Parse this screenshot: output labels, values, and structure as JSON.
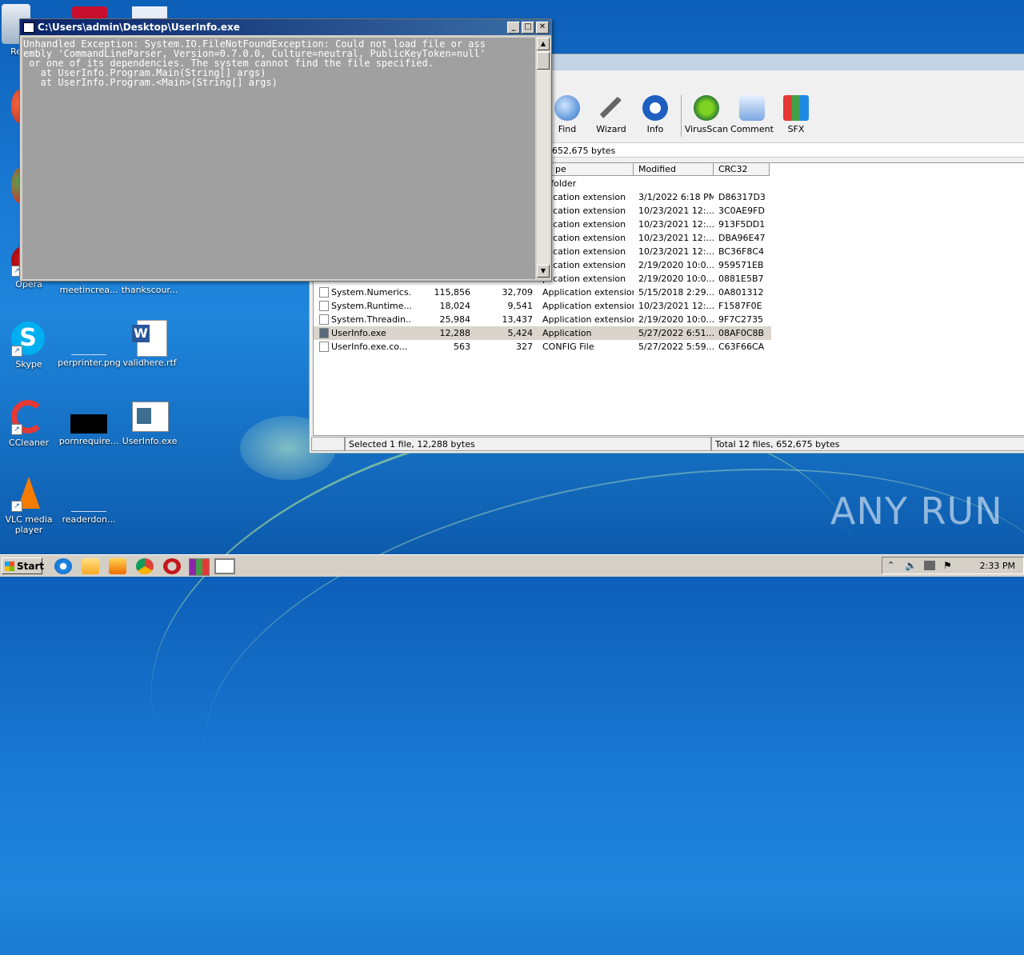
{
  "console": {
    "title": "C:\\Users\\admin\\Desktop\\UserInfo.exe",
    "lines": [
      "Unhandled Exception: System.IO.FileNotFoundException: Could not load file or ass",
      "embly 'CommandLineParser, Version=0.7.0.0, Culture=neutral, PublicKeyToken=null'",
      " or one of its dependencies. The system cannot find the file specified.",
      "   at UserInfo.Program.Main(String[] args)",
      "   at UserInfo.Program.<Main>(String[] args)"
    ],
    "btn_min": "_",
    "btn_max": "□",
    "btn_close": "✕"
  },
  "winrar": {
    "toolbar": [
      "Find",
      "Wizard",
      "Info",
      "VirusScan",
      "Comment",
      "SFX"
    ],
    "address": "652,675 bytes",
    "columns": [
      "pe",
      "Modified",
      "CRC32"
    ],
    "rows": [
      {
        "name": "",
        "size": "",
        "packed": "",
        "type": "e folder",
        "modified": "",
        "crc": ""
      },
      {
        "name": "",
        "size": "",
        "packed": "",
        "type": "plication extension",
        "modified": "3/1/2022 6:18 PM",
        "crc": "D86317D3"
      },
      {
        "name": "",
        "size": "",
        "packed": "",
        "type": "plication extension",
        "modified": "10/23/2021 12:...",
        "crc": "3C0AE9FD"
      },
      {
        "name": "",
        "size": "",
        "packed": "",
        "type": "plication extension",
        "modified": "10/23/2021 12:...",
        "crc": "913F5DD1"
      },
      {
        "name": "",
        "size": "",
        "packed": "",
        "type": "plication extension",
        "modified": "10/23/2021 12:...",
        "crc": "DBA96E47"
      },
      {
        "name": "",
        "size": "",
        "packed": "",
        "type": "plication extension",
        "modified": "10/23/2021 12:...",
        "crc": "BC36F8C4"
      },
      {
        "name": "",
        "size": "",
        "packed": "",
        "type": "plication extension",
        "modified": "2/19/2020 10:0...",
        "crc": "959571EB"
      },
      {
        "name": "",
        "size": "",
        "packed": "",
        "type": "plication extension",
        "modified": "2/19/2020 10:0...",
        "crc": "0881E5B7"
      },
      {
        "name": "System.Numerics....",
        "size": "115,856",
        "packed": "32,709",
        "type": "Application extension",
        "modified": "5/15/2018 2:29...",
        "crc": "0A801312"
      },
      {
        "name": "System.Runtime....",
        "size": "18,024",
        "packed": "9,541",
        "type": "Application extension",
        "modified": "10/23/2021 12:...",
        "crc": "F1587F0E"
      },
      {
        "name": "System.Threadin...",
        "size": "25,984",
        "packed": "13,437",
        "type": "Application extension",
        "modified": "2/19/2020 10:0...",
        "crc": "9F7C2735"
      },
      {
        "name": "UserInfo.exe",
        "size": "12,288",
        "packed": "5,424",
        "type": "Application",
        "modified": "5/27/2022 6:51...",
        "crc": "08AF0C8B"
      },
      {
        "name": "UserInfo.exe.co...",
        "size": "563",
        "packed": "327",
        "type": "CONFIG File",
        "modified": "5/27/2022 5:59...",
        "crc": "C63F66CA"
      }
    ],
    "status_left": "Selected 1 file, 12,288 bytes",
    "status_right": "Total 12 files, 652,675 bytes"
  },
  "desktop": {
    "icons": [
      {
        "label": "Re"
      },
      {
        "label": "Opera"
      },
      {
        "label": "meetincrea..."
      },
      {
        "label": "thankscour..."
      },
      {
        "label": "Skype"
      },
      {
        "label": "perprinter.png"
      },
      {
        "label": "validhere.rtf"
      },
      {
        "label": "CCleaner"
      },
      {
        "label": "pornrequire..."
      },
      {
        "label": "UserInfo.exe"
      },
      {
        "label": "VLC media player"
      },
      {
        "label": "readerdon..."
      }
    ]
  },
  "taskbar": {
    "start": "Start",
    "clock": "2:33 PM"
  },
  "watermark": "ANY RUN",
  "colors": {
    "console_bg": "#a0a0a0",
    "titlebar": "#0a246a",
    "desktop": "#1a7ad4",
    "selected_row": "#d9d4cc"
  }
}
